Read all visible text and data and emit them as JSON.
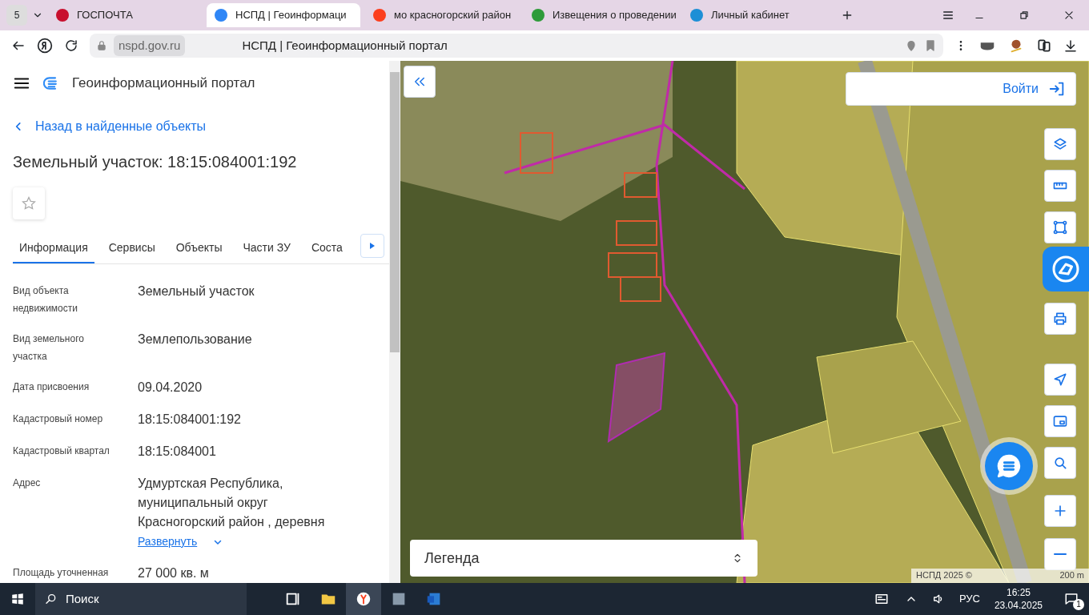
{
  "browser": {
    "tab_count": "5",
    "tabs": [
      {
        "title": "ГОСПОЧТА",
        "selected": false,
        "color": "#c8102e"
      },
      {
        "title": "НСПД | Геоинформаци",
        "selected": true,
        "color": "#2f86f6"
      },
      {
        "title": "мо красногорский район",
        "selected": false,
        "color": "#fc3f1d"
      },
      {
        "title": "Извещения о проведении",
        "selected": false,
        "color": "#2e9b3a"
      },
      {
        "title": "Личный кабинет",
        "selected": false,
        "color": "#1d8fd6"
      }
    ],
    "address": "nspd.gov.ru",
    "page_title": "НСПД | Геоинформационный портал"
  },
  "app": {
    "title": "Геоинформационный портал",
    "back_link": "Назад в найденные объекты",
    "heading": "Земельный участок: 18:15:084001:192",
    "favorite": false,
    "tabs": [
      {
        "label": "Информация",
        "selected": true
      },
      {
        "label": "Сервисы",
        "selected": false
      },
      {
        "label": "Объекты",
        "selected": false
      },
      {
        "label": "Части ЗУ",
        "selected": false
      },
      {
        "label": "Соста",
        "selected": false
      }
    ],
    "fields": [
      {
        "label": "Вид объекта недвижимости",
        "value": "Земельный участок"
      },
      {
        "label": "Вид земельного участка",
        "value": "Землепользование"
      },
      {
        "label": "Дата присвоения",
        "value": "09.04.2020"
      },
      {
        "label": "Кадастровый номер",
        "value": "18:15:084001:192"
      },
      {
        "label": "Кадастровый квартал",
        "value": "18:15:084001"
      },
      {
        "label": "Адрес",
        "value": "Удмуртская Республика, муниципальный округ Красногорский район , деревня",
        "expand_link": "Развернуть"
      },
      {
        "label": "Площадь уточненная",
        "value": "27 000 кв. м"
      }
    ]
  },
  "map": {
    "login": "Войти",
    "legend": "Легенда",
    "attribution": "НСПД 2025 ©",
    "scale": "200 m"
  },
  "taskbar": {
    "search": "Поиск",
    "language": "РУС",
    "time": "16:25",
    "date": "23.04.2025",
    "notifications": "1"
  }
}
